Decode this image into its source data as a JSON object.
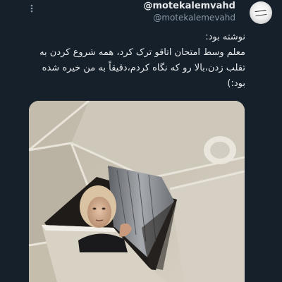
{
  "tweet": {
    "display_name": "@motekalemvahd",
    "handle": "@motekalemevahd",
    "text_lines": [
      "نوشته بود:",
      "معلم وسط امتحان اتاقو ترک کرد، همه شروع کردن به",
      "تقلب زدن،بالا رو که نگاه کردم،دقیقاً به من خیره شده",
      "بود:)"
    ]
  },
  "icons": {
    "more": "more-options-icon"
  }
}
